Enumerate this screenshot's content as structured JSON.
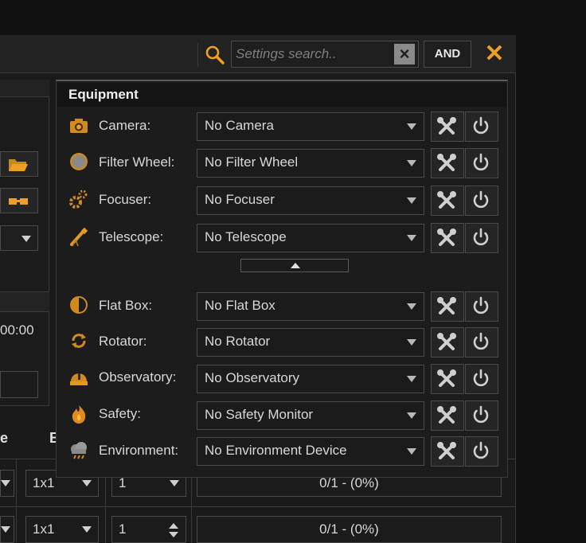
{
  "search": {
    "placeholder": "Settings search..",
    "value": ""
  },
  "toolbar": {
    "and_label": "AND"
  },
  "left_panel": {
    "time_fragment": "00:00"
  },
  "table": {
    "col_e": "e",
    "col_b": "B",
    "rows": [
      {
        "binning": "1x1",
        "count": "1",
        "progress": "0/1 - (0%)"
      },
      {
        "binning": "1x1",
        "count": "1",
        "progress": "0/1 - (0%)"
      }
    ]
  },
  "equipment": {
    "title": "Equipment",
    "items": [
      {
        "label": "Camera:",
        "value": "No Camera",
        "icon": "camera-icon"
      },
      {
        "label": "Filter Wheel:",
        "value": "No Filter Wheel",
        "icon": "filter-wheel-icon"
      },
      {
        "label": "Focuser:",
        "value": "No Focuser",
        "icon": "focuser-icon"
      },
      {
        "label": "Telescope:",
        "value": "No Telescope",
        "icon": "telescope-icon"
      },
      {
        "label": "Flat Box:",
        "value": "No Flat Box",
        "icon": "flat-box-icon"
      },
      {
        "label": "Rotator:",
        "value": "No Rotator",
        "icon": "rotator-icon"
      },
      {
        "label": "Observatory:",
        "value": "No Observatory",
        "icon": "observatory-icon"
      },
      {
        "label": "Safety:",
        "value": "No Safety Monitor",
        "icon": "safety-icon"
      },
      {
        "label": "Environment:",
        "value": "No Environment Device",
        "icon": "environment-icon"
      }
    ]
  },
  "colors": {
    "accent": "#f0a020",
    "background": "#1c1c1c",
    "border": "#4a4a4a",
    "text": "#d8d8d8"
  }
}
